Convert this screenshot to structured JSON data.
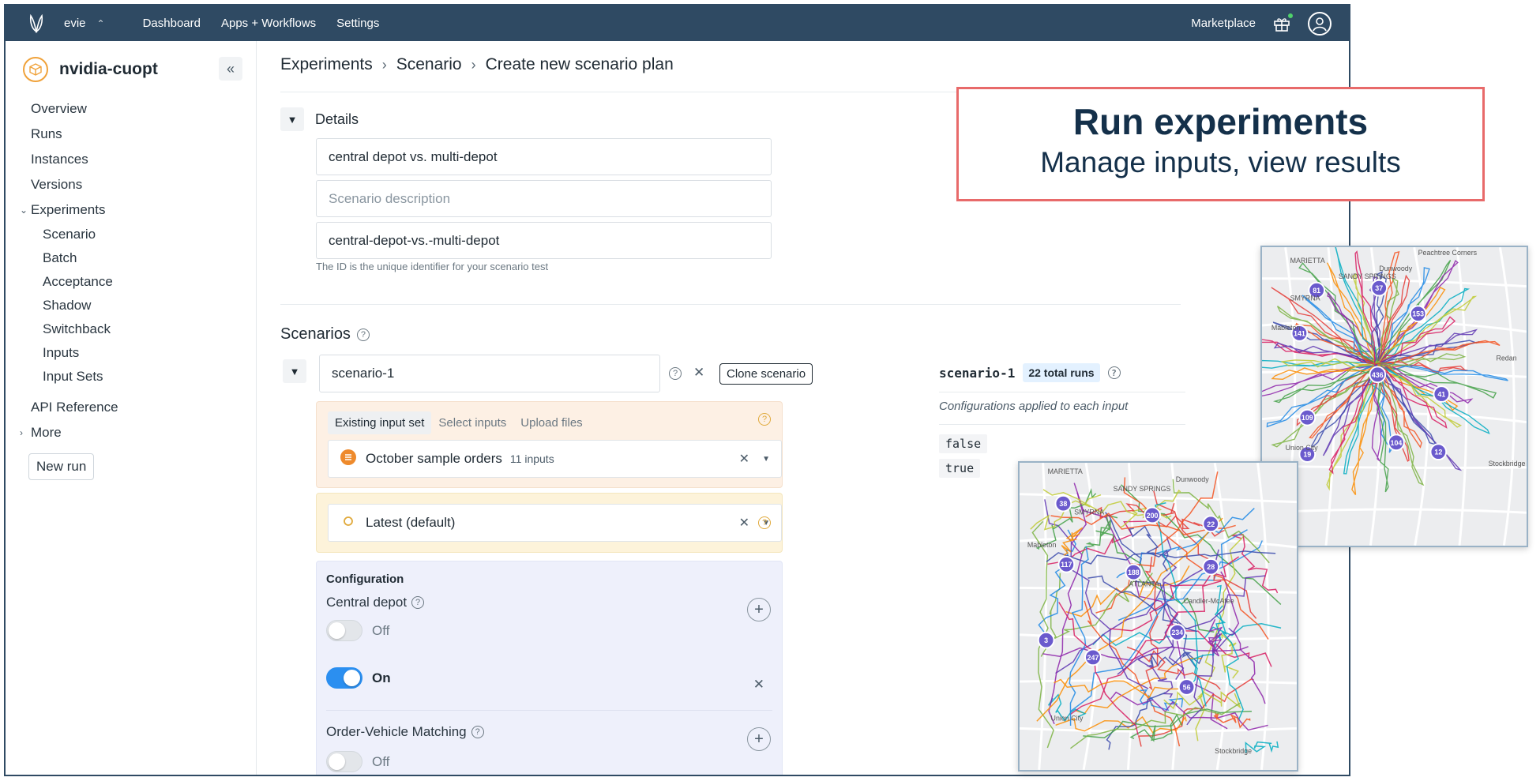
{
  "topnav": {
    "org_name": "evie",
    "links": [
      "Dashboard",
      "Apps + Workflows",
      "Settings"
    ],
    "marketplace": "Marketplace"
  },
  "sidebar": {
    "project_name": "nvidia-cuopt",
    "items": [
      "Overview",
      "Runs",
      "Instances",
      "Versions",
      "Experiments"
    ],
    "experiments_sub": [
      "Scenario",
      "Batch",
      "Acceptance",
      "Shadow",
      "Switchback",
      "Inputs",
      "Input Sets"
    ],
    "api_reference": "API Reference",
    "more": "More",
    "new_run": "New run"
  },
  "breadcrumb": [
    "Experiments",
    "Scenario",
    "Create new scenario plan"
  ],
  "details": {
    "heading": "Details",
    "name_value": "central depot vs. multi-depot",
    "description_placeholder": "Scenario description",
    "id_value": "central-depot-vs.-multi-depot",
    "id_hint": "The ID is the unique identifier for your scenario test"
  },
  "scenarios": {
    "heading": "Scenarios",
    "scenario_name": "scenario-1",
    "clone_label": "Clone scenario",
    "tabs": [
      "Existing input set",
      "Select inputs",
      "Upload files"
    ],
    "input_set": "October sample orders",
    "input_count": "11 inputs",
    "instance": "Latest (default)",
    "configuration": {
      "title": "Configuration",
      "central_depot_label": "Central depot",
      "off_label": "Off",
      "on_label": "On",
      "order_vehicle_label": "Order-Vehicle Matching"
    }
  },
  "summary": {
    "name": "scenario-1",
    "badge": "22 total runs",
    "subtitle": "Configurations applied to each input",
    "values": [
      "false",
      "true"
    ]
  },
  "callout": {
    "title": "Run experiments",
    "subtitle": "Manage inputs, view results"
  },
  "maps": {
    "map1_places": [
      "MARIETTA",
      "SANDY SPRINGS",
      "SMYRNA",
      "Peachtree Corners",
      "Dunwoody",
      "Mableton",
      "Redan",
      "Stockbridge",
      "Union City"
    ],
    "map1_clusters": [
      "81",
      "37",
      "153",
      "141",
      "436",
      "41",
      "109",
      "104",
      "19",
      "12"
    ],
    "map2_places": [
      "MARIETTA",
      "SANDY SPRINGS",
      "SMYRNA",
      "ATLANTA",
      "Dunwoody",
      "Mableton",
      "Candler-McAfee",
      "Union City",
      "Stockbridge"
    ],
    "map2_clusters": [
      "38",
      "200",
      "22",
      "117",
      "188",
      "28",
      "234",
      "3",
      "247",
      "56"
    ],
    "route_colors": [
      "#e53935",
      "#1e88e5",
      "#43a047",
      "#8e24aa",
      "#fb8c00",
      "#00acc1",
      "#c0ca33",
      "#d81b60",
      "#5e35b1",
      "#3949ab",
      "#f4511e",
      "#7cb342"
    ]
  }
}
